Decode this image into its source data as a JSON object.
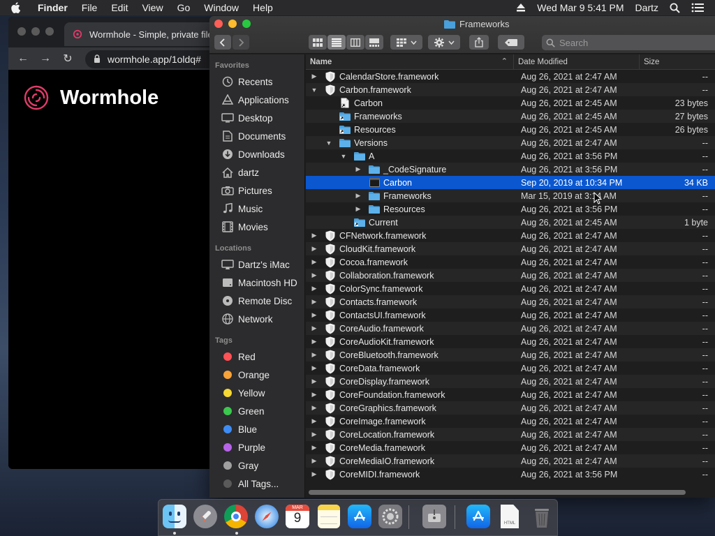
{
  "menubar": {
    "app_name": "Finder",
    "menus": [
      "File",
      "Edit",
      "View",
      "Go",
      "Window",
      "Help"
    ],
    "datetime": "Wed Mar 9  5:41 PM",
    "user": "Dartz"
  },
  "browser": {
    "tab_title": "Wormhole - Simple, private file",
    "url": "wormhole.app/1oldq#",
    "brand": "Wormhole",
    "brand_color": "#e23b6a"
  },
  "finder": {
    "title": "Frameworks",
    "search_placeholder": "Search",
    "sidebar": {
      "favorites_header": "Favorites",
      "favorites": [
        {
          "label": "Recents",
          "icon": "clock-icon"
        },
        {
          "label": "Applications",
          "icon": "applications-icon"
        },
        {
          "label": "Desktop",
          "icon": "desktop-icon"
        },
        {
          "label": "Documents",
          "icon": "documents-icon"
        },
        {
          "label": "Downloads",
          "icon": "downloads-icon"
        },
        {
          "label": "dartz",
          "icon": "home-icon"
        },
        {
          "label": "Pictures",
          "icon": "camera-icon"
        },
        {
          "label": "Music",
          "icon": "music-icon"
        },
        {
          "label": "Movies",
          "icon": "film-icon"
        }
      ],
      "locations_header": "Locations",
      "locations": [
        {
          "label": "Dartz's iMac",
          "icon": "imac-icon"
        },
        {
          "label": "Macintosh HD",
          "icon": "disk-icon"
        },
        {
          "label": "Remote Disc",
          "icon": "disc-icon"
        },
        {
          "label": "Network",
          "icon": "globe-icon"
        }
      ],
      "tags_header": "Tags",
      "tags": [
        {
          "label": "Red",
          "color": "#ff5257"
        },
        {
          "label": "Orange",
          "color": "#f7a33a"
        },
        {
          "label": "Yellow",
          "color": "#f5d833"
        },
        {
          "label": "Green",
          "color": "#3cc74e"
        },
        {
          "label": "Blue",
          "color": "#3d8cf5"
        },
        {
          "label": "Purple",
          "color": "#b763e8"
        },
        {
          "label": "Gray",
          "color": "#a0a0a0"
        },
        {
          "label": "All Tags...",
          "color": "#5a5a5a"
        }
      ]
    },
    "columns": {
      "name": "Name",
      "date": "Date Modified",
      "size": "Size"
    },
    "rows": [
      {
        "name": "CalendarStore.framework",
        "date": "Aug 26, 2021 at 2:47 AM",
        "size": "--",
        "depth": 0,
        "disclosure": "closed",
        "icon": "framework"
      },
      {
        "name": "Carbon.framework",
        "date": "Aug 26, 2021 at 2:47 AM",
        "size": "--",
        "depth": 0,
        "disclosure": "open",
        "icon": "framework"
      },
      {
        "name": "Carbon",
        "date": "Aug 26, 2021 at 2:45 AM",
        "size": "23 bytes",
        "depth": 1,
        "disclosure": "none",
        "icon": "alias-file"
      },
      {
        "name": "Frameworks",
        "date": "Aug 26, 2021 at 2:45 AM",
        "size": "27 bytes",
        "depth": 1,
        "disclosure": "none",
        "icon": "alias-folder"
      },
      {
        "name": "Resources",
        "date": "Aug 26, 2021 at 2:45 AM",
        "size": "26 bytes",
        "depth": 1,
        "disclosure": "none",
        "icon": "alias-folder"
      },
      {
        "name": "Versions",
        "date": "Aug 26, 2021 at 2:47 AM",
        "size": "--",
        "depth": 1,
        "disclosure": "open",
        "icon": "folder"
      },
      {
        "name": "A",
        "date": "Aug 26, 2021 at 3:56 PM",
        "size": "--",
        "depth": 2,
        "disclosure": "open",
        "icon": "folder"
      },
      {
        "name": "_CodeSignature",
        "date": "Aug 26, 2021 at 3:56 PM",
        "size": "--",
        "depth": 3,
        "disclosure": "closed",
        "icon": "folder"
      },
      {
        "name": "Carbon",
        "date": "Sep 20, 2019 at 10:34 PM",
        "size": "34 KB",
        "depth": 3,
        "disclosure": "none",
        "icon": "exec",
        "selected": true
      },
      {
        "name": "Frameworks",
        "date": "Mar 15, 2019 at 3:14 AM",
        "size": "--",
        "depth": 3,
        "disclosure": "closed",
        "icon": "folder"
      },
      {
        "name": "Resources",
        "date": "Aug 26, 2021 at 3:56 PM",
        "size": "--",
        "depth": 3,
        "disclosure": "closed",
        "icon": "folder"
      },
      {
        "name": "Current",
        "date": "Aug 26, 2021 at 2:45 AM",
        "size": "1 byte",
        "depth": 2,
        "disclosure": "none",
        "icon": "alias-folder"
      },
      {
        "name": "CFNetwork.framework",
        "date": "Aug 26, 2021 at 2:47 AM",
        "size": "--",
        "depth": 0,
        "disclosure": "closed",
        "icon": "framework"
      },
      {
        "name": "CloudKit.framework",
        "date": "Aug 26, 2021 at 2:47 AM",
        "size": "--",
        "depth": 0,
        "disclosure": "closed",
        "icon": "framework"
      },
      {
        "name": "Cocoa.framework",
        "date": "Aug 26, 2021 at 2:47 AM",
        "size": "--",
        "depth": 0,
        "disclosure": "closed",
        "icon": "framework"
      },
      {
        "name": "Collaboration.framework",
        "date": "Aug 26, 2021 at 2:47 AM",
        "size": "--",
        "depth": 0,
        "disclosure": "closed",
        "icon": "framework"
      },
      {
        "name": "ColorSync.framework",
        "date": "Aug 26, 2021 at 2:47 AM",
        "size": "--",
        "depth": 0,
        "disclosure": "closed",
        "icon": "framework"
      },
      {
        "name": "Contacts.framework",
        "date": "Aug 26, 2021 at 2:47 AM",
        "size": "--",
        "depth": 0,
        "disclosure": "closed",
        "icon": "framework"
      },
      {
        "name": "ContactsUI.framework",
        "date": "Aug 26, 2021 at 2:47 AM",
        "size": "--",
        "depth": 0,
        "disclosure": "closed",
        "icon": "framework"
      },
      {
        "name": "CoreAudio.framework",
        "date": "Aug 26, 2021 at 2:47 AM",
        "size": "--",
        "depth": 0,
        "disclosure": "closed",
        "icon": "framework"
      },
      {
        "name": "CoreAudioKit.framework",
        "date": "Aug 26, 2021 at 2:47 AM",
        "size": "--",
        "depth": 0,
        "disclosure": "closed",
        "icon": "framework"
      },
      {
        "name": "CoreBluetooth.framework",
        "date": "Aug 26, 2021 at 2:47 AM",
        "size": "--",
        "depth": 0,
        "disclosure": "closed",
        "icon": "framework"
      },
      {
        "name": "CoreData.framework",
        "date": "Aug 26, 2021 at 2:47 AM",
        "size": "--",
        "depth": 0,
        "disclosure": "closed",
        "icon": "framework"
      },
      {
        "name": "CoreDisplay.framework",
        "date": "Aug 26, 2021 at 2:47 AM",
        "size": "--",
        "depth": 0,
        "disclosure": "closed",
        "icon": "framework"
      },
      {
        "name": "CoreFoundation.framework",
        "date": "Aug 26, 2021 at 2:47 AM",
        "size": "--",
        "depth": 0,
        "disclosure": "closed",
        "icon": "framework"
      },
      {
        "name": "CoreGraphics.framework",
        "date": "Aug 26, 2021 at 2:47 AM",
        "size": "--",
        "depth": 0,
        "disclosure": "closed",
        "icon": "framework"
      },
      {
        "name": "CoreImage.framework",
        "date": "Aug 26, 2021 at 2:47 AM",
        "size": "--",
        "depth": 0,
        "disclosure": "closed",
        "icon": "framework"
      },
      {
        "name": "CoreLocation.framework",
        "date": "Aug 26, 2021 at 2:47 AM",
        "size": "--",
        "depth": 0,
        "disclosure": "closed",
        "icon": "framework"
      },
      {
        "name": "CoreMedia.framework",
        "date": "Aug 26, 2021 at 2:47 AM",
        "size": "--",
        "depth": 0,
        "disclosure": "closed",
        "icon": "framework"
      },
      {
        "name": "CoreMediaIO.framework",
        "date": "Aug 26, 2021 at 2:47 AM",
        "size": "--",
        "depth": 0,
        "disclosure": "closed",
        "icon": "framework"
      },
      {
        "name": "CoreMIDI.framework",
        "date": "Aug 26, 2021 at 3:56 PM",
        "size": "--",
        "depth": 0,
        "disclosure": "closed",
        "icon": "framework"
      }
    ],
    "accent": "#0a57d0"
  },
  "dock": {
    "items": [
      "finder-icon",
      "launchpad-icon",
      "chrome-icon",
      "safari-icon",
      "calendar-icon",
      "notes-icon",
      "app-store-icon",
      "system-preferences-icon",
      "disk-utility-icon",
      "app-store-icon",
      "html-file-icon",
      "trash-icon"
    ],
    "calendar_month": "MAR",
    "calendar_day": "9",
    "html_label": "HTML"
  }
}
